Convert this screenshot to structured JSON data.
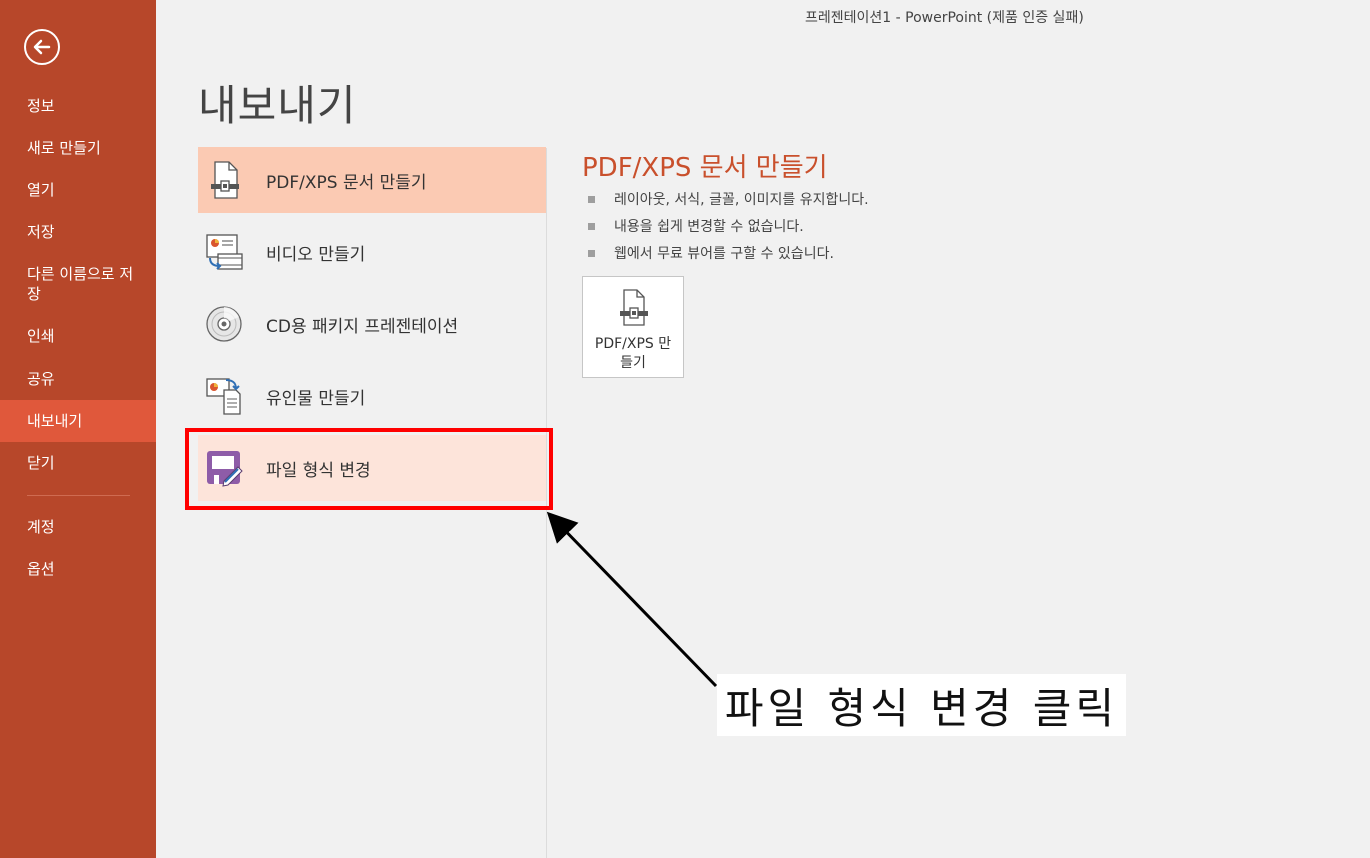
{
  "window": {
    "title": "프레젠테이션1 - PowerPoint (제품 인증 실패)"
  },
  "sidebar": {
    "back_icon": "back-arrow-icon",
    "items": [
      {
        "label": "정보"
      },
      {
        "label": "새로 만들기"
      },
      {
        "label": "열기"
      },
      {
        "label": "저장"
      },
      {
        "label": "다른 이름으로 저장"
      },
      {
        "label": "인쇄"
      },
      {
        "label": "공유"
      },
      {
        "label": "내보내기",
        "active": true
      },
      {
        "label": "닫기"
      },
      {
        "label": "계정"
      },
      {
        "label": "옵션"
      }
    ],
    "colors": {
      "background": "#b7472a",
      "active": "#e0583b"
    }
  },
  "page": {
    "title": "내보내기"
  },
  "export_options": [
    {
      "label": "PDF/XPS 문서 만들기",
      "icon": "pdf-document-icon",
      "state": "selected"
    },
    {
      "label": "비디오 만들기",
      "icon": "video-icon"
    },
    {
      "label": "CD용 패키지 프레젠테이션",
      "icon": "cd-icon"
    },
    {
      "label": "유인물 만들기",
      "icon": "handout-icon"
    },
    {
      "label": "파일 형식 변경",
      "icon": "file-format-icon",
      "state": "hover"
    }
  ],
  "detail": {
    "title": "PDF/XPS 문서 만들기",
    "bullets": [
      "레이아웃, 서식, 글꼴, 이미지를 유지합니다.",
      "내용을 쉽게 변경할 수 없습니다.",
      "웹에서 무료 뷰어를 구할 수 있습니다."
    ],
    "button_label": "PDF/XPS 만들기",
    "accent_color": "#c9502c"
  },
  "annotation": {
    "text": "파일 형식 변경 클릭"
  }
}
